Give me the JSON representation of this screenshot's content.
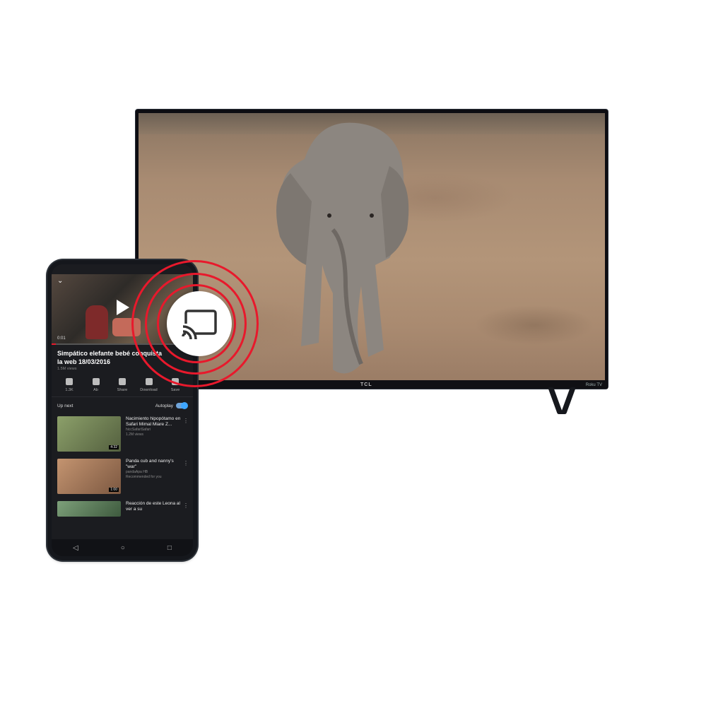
{
  "tv": {
    "brand": "TCL",
    "badge": "Roku TV"
  },
  "phone": {
    "status_left": "",
    "status_right": "",
    "video": {
      "time": "0:01",
      "progress": 0.03
    },
    "video_title": "Simpático elefante bebé conquista la web 18/03/2016",
    "views": "1.5M views",
    "actions": [
      {
        "icon": "thumbs-up-icon",
        "label": "1.3K"
      },
      {
        "icon": "thumbs-down-icon",
        "label": "Ab"
      },
      {
        "icon": "share-icon",
        "label": "Share"
      },
      {
        "icon": "download-icon",
        "label": "Download"
      },
      {
        "icon": "save-icon",
        "label": "Save"
      }
    ],
    "up_next": {
      "label": "Up next",
      "autoplay_label": "Autoplay",
      "autoplay_on": true
    },
    "recommendations": [
      {
        "title": "Nacimiento hipopótamo en Safari Mimal Miare Z...",
        "meta": "hiccSafariSafari\n1.2M views",
        "duration": "4:32",
        "color": "#7a8a56"
      },
      {
        "title": "Panda cub and nanny's \"war\"",
        "meta": "pandaApa HB\nRecommended for you",
        "duration": "1:00",
        "color": "#b07a5a"
      },
      {
        "title": "Reacción de este Leona al ver a su",
        "meta": "",
        "duration": "",
        "color": "#6c8b6a"
      }
    ],
    "nav": [
      "◁",
      "○",
      "□"
    ]
  },
  "cast": {
    "icon": "cast-icon",
    "accent": "#e8192c"
  }
}
